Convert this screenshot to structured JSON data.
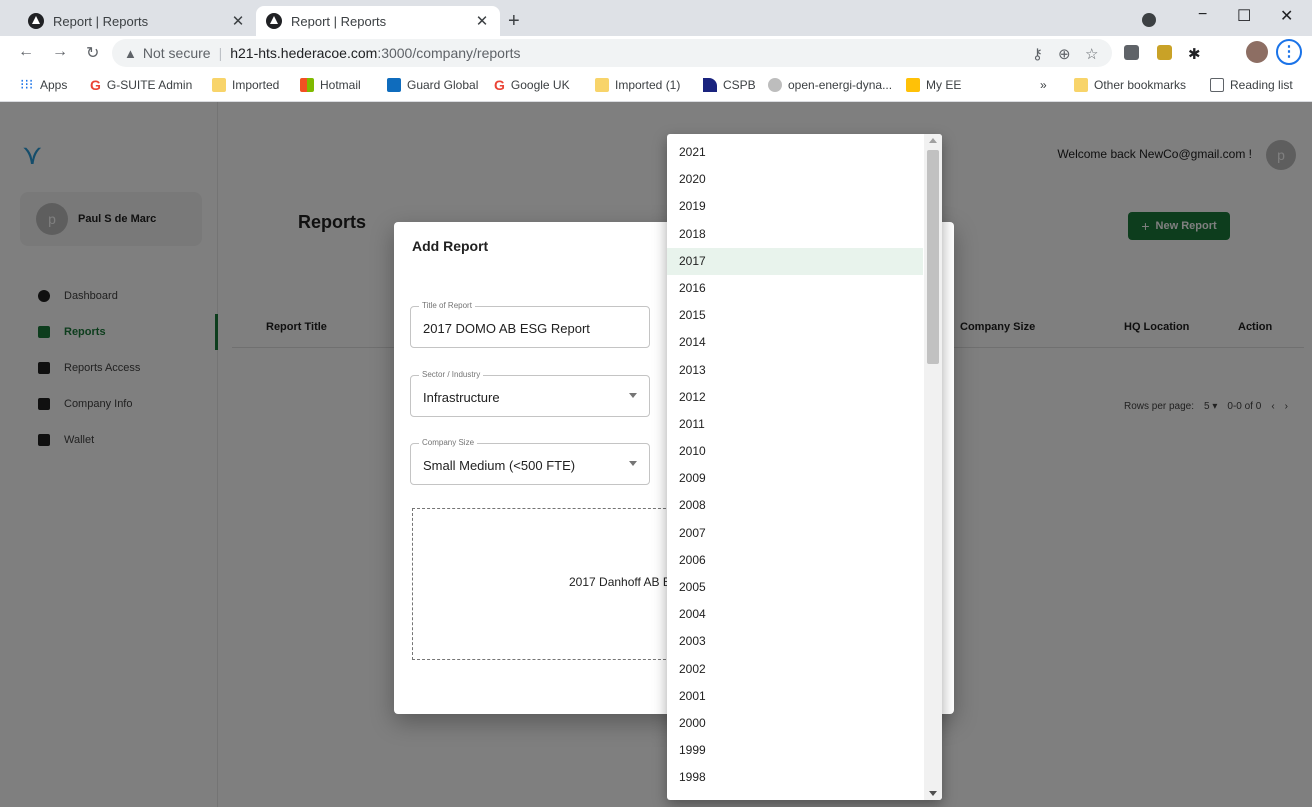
{
  "browser": {
    "tabs": [
      {
        "label": "Report | Reports",
        "active": false
      },
      {
        "label": "Report | Reports",
        "active": true
      }
    ],
    "new_tab": "+",
    "window_controls": {
      "minimize": "−",
      "maximize": "☐",
      "close": "✕"
    },
    "address": {
      "security": "Not secure",
      "host": "h21-hts.hederacoe.com",
      "path": ":3000/company/reports"
    },
    "bookmarks": [
      {
        "label": "Apps",
        "icon": "apps-grid-icon"
      },
      {
        "label": "G-SUITE Admin",
        "icon": "google-icon"
      },
      {
        "label": "Imported",
        "icon": "folder-icon"
      },
      {
        "label": "Hotmail",
        "icon": "microsoft-icon"
      },
      {
        "label": "Guard Global",
        "icon": "outlook-icon"
      },
      {
        "label": "Google UK",
        "icon": "google-icon"
      },
      {
        "label": "Imported (1)",
        "icon": "folder-icon"
      },
      {
        "label": "CSPB",
        "icon": "cspb-icon"
      },
      {
        "label": "open-energi-dyna...",
        "icon": "toggle-icon"
      },
      {
        "label": "My EE",
        "icon": "ee-icon"
      }
    ],
    "bookmarks_overflow": "»",
    "other_bookmarks": "Other bookmarks",
    "reading_list": "Reading list"
  },
  "app": {
    "user_name": "Paul S de Marc",
    "user_initial": "p",
    "nav": [
      {
        "label": "Dashboard",
        "active": false
      },
      {
        "label": "Reports",
        "active": true
      },
      {
        "label": "Reports Access",
        "active": false
      },
      {
        "label": "Company Info",
        "active": false
      },
      {
        "label": "Wallet",
        "active": false
      }
    ],
    "welcome": "Welcome back NewCo@gmail.com !",
    "top_avatar_initial": "p",
    "page_title": "Reports",
    "new_report_label": "New Report",
    "table_headers": {
      "report_title": "Report Title",
      "company_size": "Company Size",
      "hq_location": "HQ Location",
      "action": "Action"
    },
    "pagination": {
      "rows_per_page_label": "Rows per page:",
      "rows_per_page_value": "5",
      "range": "0-0 of 0"
    }
  },
  "modal": {
    "title": "Add Report",
    "fields": {
      "title_of_report": {
        "label": "Title of Report",
        "value": "2017 DOMO AB ESG Report"
      },
      "sector": {
        "label": "Sector / Industry",
        "value": "Infrastructure"
      },
      "company_size": {
        "label": "Company Size",
        "value": "Small Medium (<500 FTE)"
      }
    },
    "dropzone_text": "2017 Danhoff AB E"
  },
  "year_listbox": {
    "selected": "2017",
    "options": [
      "2021",
      "2020",
      "2019",
      "2018",
      "2017",
      "2016",
      "2015",
      "2014",
      "2013",
      "2012",
      "2011",
      "2010",
      "2009",
      "2008",
      "2007",
      "2006",
      "2005",
      "2004",
      "2003",
      "2002",
      "2001",
      "2000",
      "1999",
      "1998"
    ]
  }
}
